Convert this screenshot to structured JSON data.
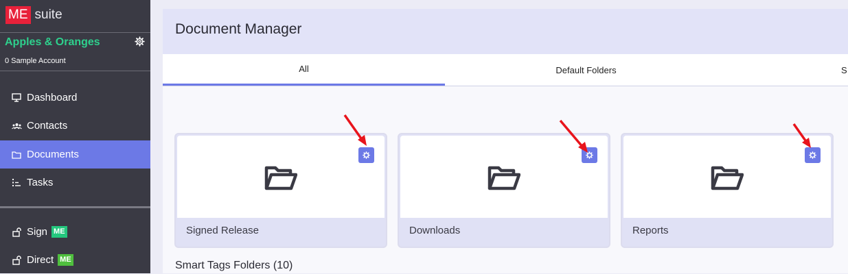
{
  "app": {
    "logo_mark": "ME",
    "logo_text": "suite"
  },
  "account": {
    "company": "Apples & Oranges",
    "subtitle": "0 Sample Account",
    "settings_icon": "gear-icon"
  },
  "sidebar": {
    "items": [
      {
        "label": "Dashboard",
        "icon": "monitor-icon",
        "active": false
      },
      {
        "label": "Contacts",
        "icon": "contacts-icon",
        "active": false
      },
      {
        "label": "Documents",
        "icon": "folder-icon",
        "active": true
      },
      {
        "label": "Tasks",
        "icon": "tasks-icon",
        "active": false
      }
    ],
    "apps": [
      {
        "label": "Sign",
        "badge": "ME",
        "icon": "unlock-icon"
      },
      {
        "label": "Direct",
        "badge": "ME",
        "icon": "unlock-icon"
      }
    ]
  },
  "main": {
    "title": "Document Manager",
    "tabs": [
      {
        "label": "All",
        "active": true
      },
      {
        "label": "Default Folders",
        "active": false
      },
      {
        "label": "S",
        "active": false
      }
    ],
    "folders": [
      {
        "name": "Signed Release",
        "icon": "folder-open-icon",
        "settings_icon": "gear-icon"
      },
      {
        "name": "Downloads",
        "icon": "folder-open-icon",
        "settings_icon": "gear-icon"
      },
      {
        "name": "Reports",
        "icon": "folder-open-icon",
        "settings_icon": "gear-icon"
      }
    ],
    "smart_tags_title": "Smart Tags Folders (10)"
  },
  "colors": {
    "accent": "#6c79e6",
    "brand_red": "#e8213a",
    "brand_green": "#2ed08d",
    "sidebar_bg": "#3a3a44",
    "annotation_arrow": "#e8141c"
  }
}
